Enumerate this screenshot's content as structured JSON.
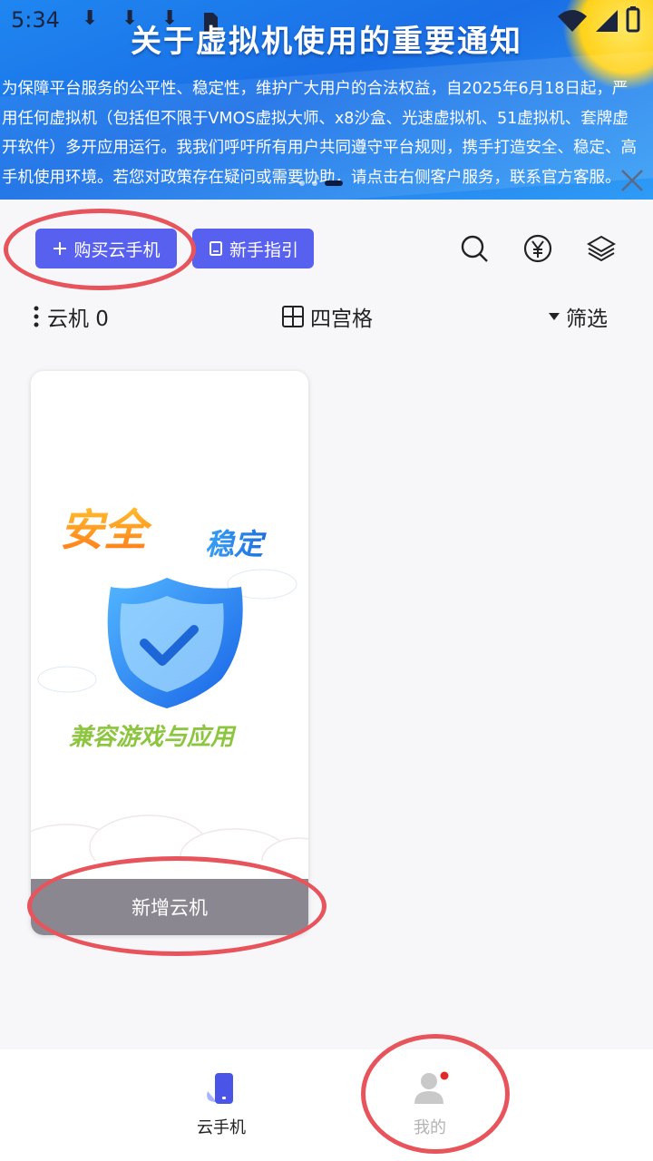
{
  "status_bar": {
    "time": "5:34",
    "download_icons": [
      "⬇",
      "⬇",
      "⬇"
    ]
  },
  "banner": {
    "title": "关于虚拟机使用的重要通知",
    "lines": [
      "为保障平台服务的公平性、稳定性，维护广大用户的合法权益，自2025年6月18日起，严",
      "用任何虚拟机（包括但不限于VMOS虚拟大师、x8沙盒、光速虚拟机、51虚拟机、套牌虚",
      "开软件）多开应用运行。我我们呼吁所有用户共同遵守平台规则，携手打造安全、稳定、高",
      "手机使用环境。若您对政策存在疑问或需要协助，请点击右侧客户服务，联系官方客服。"
    ]
  },
  "toolbar": {
    "buy_label": "购买云手机",
    "guide_label": "新手指引",
    "icons": [
      "search-icon",
      "yuan-coin-icon",
      "layers-icon"
    ]
  },
  "filter_row": {
    "cloud_label": "云机 0",
    "grid_label": "四宫格",
    "filter_label": "筛选"
  },
  "card": {
    "illustration_text": {
      "safe": "安全",
      "stable": "稳定",
      "compat": "兼容游戏与应用"
    },
    "add_button": "新增云机"
  },
  "bottom_nav": {
    "items": [
      {
        "label": "云手机",
        "active": true
      },
      {
        "label": "我的",
        "active": false,
        "badge": true
      }
    ]
  },
  "colors": {
    "primary": "#5860f0",
    "annotation": "#e8545c",
    "banner_blue": "#1a6fe6"
  }
}
